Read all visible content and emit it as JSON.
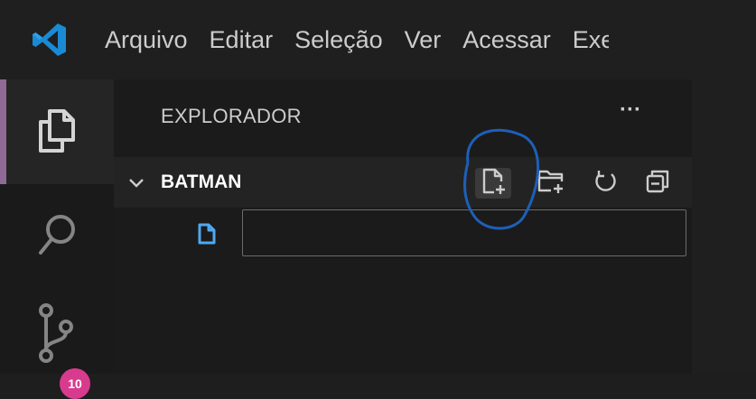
{
  "menu": {
    "items": [
      "Arquivo",
      "Editar",
      "Seleção",
      "Ver",
      "Acessar",
      "Exec"
    ]
  },
  "activity": {
    "explorer_icon": "files-icon",
    "search_icon": "search-icon",
    "scm_icon": "source-control-icon",
    "scm_badge": "10"
  },
  "explorer": {
    "title": "EXPLORADOR",
    "more_label": "···",
    "section_label": "BATMAN",
    "new_file_value": "",
    "actions": [
      "new-file-icon",
      "new-folder-icon",
      "refresh-icon",
      "collapse-all-icon"
    ]
  },
  "colors": {
    "accent_active": "#8f6a96",
    "badge": "#d83b8e",
    "vscode_blue": "#1a8ad4",
    "annotation": "#1e5fb8"
  }
}
